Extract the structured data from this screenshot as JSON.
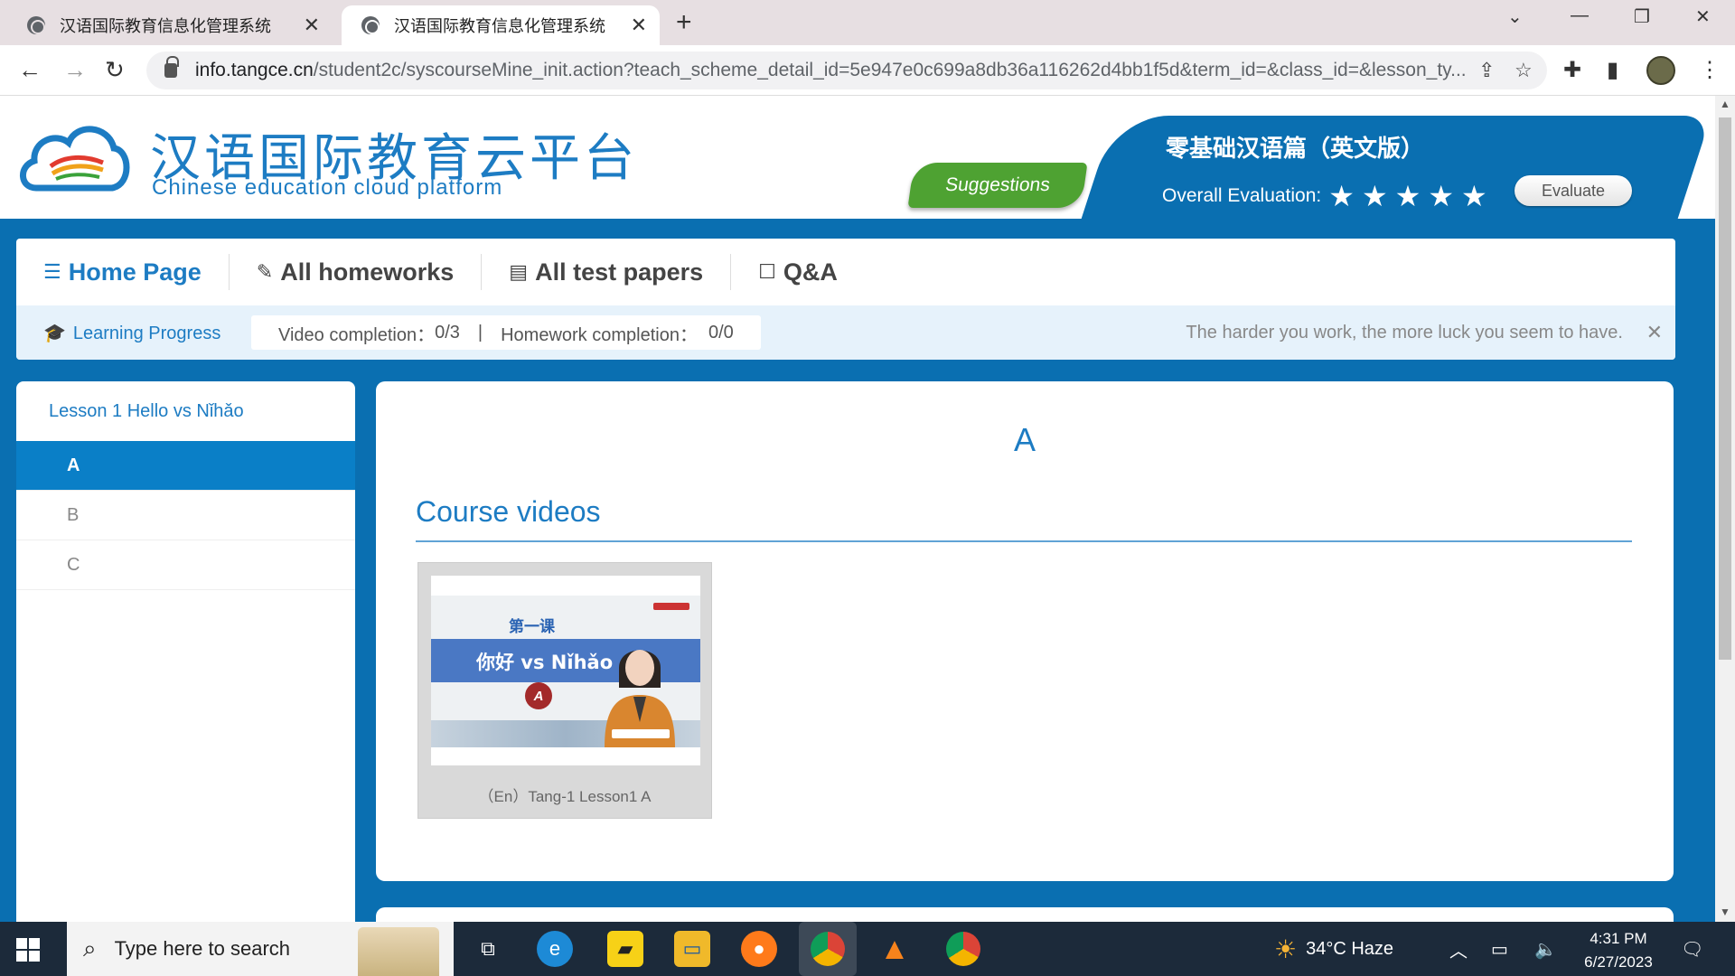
{
  "browser": {
    "tabs": [
      {
        "title": "汉语国际教育信息化管理系统",
        "active": false
      },
      {
        "title": "汉语国际教育信息化管理系统",
        "active": true
      }
    ],
    "url_host": "info.tangce.cn",
    "url_path": "/student2c/syscourseMine_init.action?teach_scheme_detail_id=5e947e0c699a8db36a116262d4bb1f5d&term_id=&class_id=&lesson_ty..."
  },
  "header": {
    "logo_cn": "汉语国际教育云平台",
    "logo_en": "Chinese education cloud platform",
    "suggestions_label": "Suggestions",
    "course_title": "零基础汉语篇（英文版）",
    "overall_label": "Overall Evaluation:",
    "stars": 5,
    "evaluate_label": "Evaluate"
  },
  "nav": {
    "items": [
      {
        "label": "Home Page",
        "icon": "list-icon",
        "active": true
      },
      {
        "label": "All homeworks",
        "icon": "edit-icon",
        "active": false
      },
      {
        "label": "All test papers",
        "icon": "paper-icon",
        "active": false
      },
      {
        "label": "Q&A",
        "icon": "chat-icon",
        "active": false
      }
    ]
  },
  "progress": {
    "label": "Learning Progress",
    "video_label": "Video completion：",
    "video_value": "0/3",
    "separator": "|",
    "homework_label": "Homework completion：",
    "homework_value": "0/0",
    "motto": "The harder you work, the more luck you seem to have."
  },
  "sidebar": {
    "lesson_title": "Lesson 1 Hello vs Nǐhǎo",
    "items": [
      {
        "label": "A",
        "active": true
      },
      {
        "label": "B",
        "active": false
      },
      {
        "label": "C",
        "active": false
      }
    ]
  },
  "content": {
    "section_title": "A",
    "videos_heading": "Course videos",
    "videos": [
      {
        "thumb_lesson": "第一课",
        "thumb_text": "你好 vs Nǐhǎo",
        "thumb_badge": "A",
        "caption": "（En）Tang-1 Lesson1 A"
      }
    ]
  },
  "taskbar": {
    "search_placeholder": "Type here to search",
    "weather": "34°C  Haze",
    "time": "4:31 PM",
    "date": "6/27/2023"
  },
  "colors": {
    "brand_blue": "#0a6fb1",
    "accent_blue": "#1d7cc3",
    "suggest_green": "#4ea232"
  }
}
